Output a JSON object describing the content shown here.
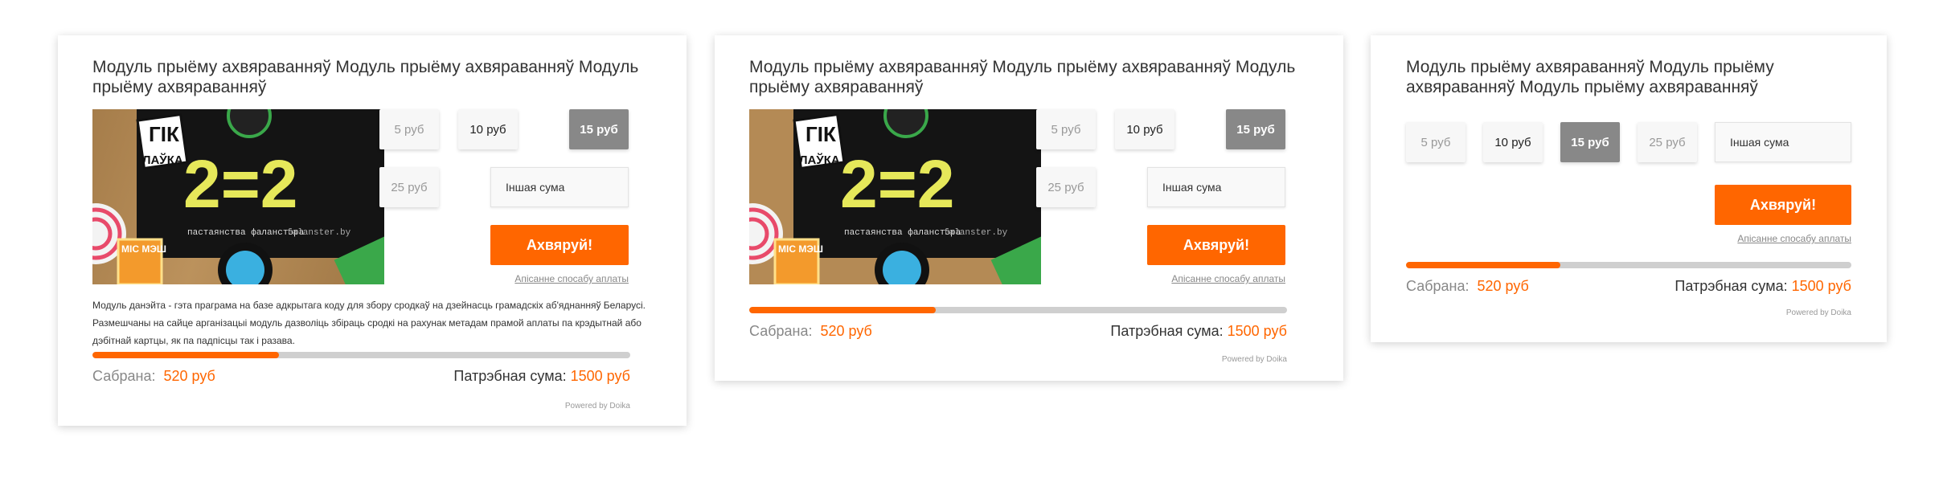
{
  "widgets": [
    {
      "title": "Модуль прыёму ахвяраванняў Модуль прыёму ахвяраванняў Модуль прыёму ахвяраванняў",
      "description": "Модуль данэйта - гэта праграма на базе адкрытага коду для збору сродкаў на дзейнасць грамадскіх аб'яднанняў Беларусі. Размешчаны на сайце арганізацыі модуль дазволіць збіраць сродкі на рахунак метадам прамой аплаты па крэдытнай або дэбітнай картцы, як па падпісцы так і разава."
    },
    {
      "title": "Модуль прыёму ахвяраванняў Модуль прыёму ахвяраванняў Модуль прыёму ахвяраванняў"
    },
    {
      "title": "Модуль прыёму ахвяраванняў Модуль прыёму ахвяраванняў Модуль прыёму ахвяраванняў"
    }
  ],
  "amounts": [
    "5 руб",
    "10 руб",
    "15 руб",
    "25 руб"
  ],
  "selected_amount": "15 руб",
  "other_amount_label": "Іншая сума",
  "donate_label": "Ахвяруй!",
  "payment_link": "Апісанне спосабу аплаты",
  "collected_label": "Сабрана:",
  "collected_value": "520 руб",
  "needed_label": "Патрэбная сума:",
  "needed_value": "1500 руб",
  "progress_fraction": 0.347,
  "powered_by": "Powered by Doika",
  "photo_text": {
    "logo_top": "ГІК",
    "logo_bottom": "ЛАЎКА",
    "equation": "2=2",
    "caption": "пастаянства фаланстэра",
    "url": "falanster.by",
    "badge": "МІС МЭШ"
  },
  "colors": {
    "accent": "#ff6600",
    "selected": "#888888",
    "track": "#cfcfcf"
  }
}
